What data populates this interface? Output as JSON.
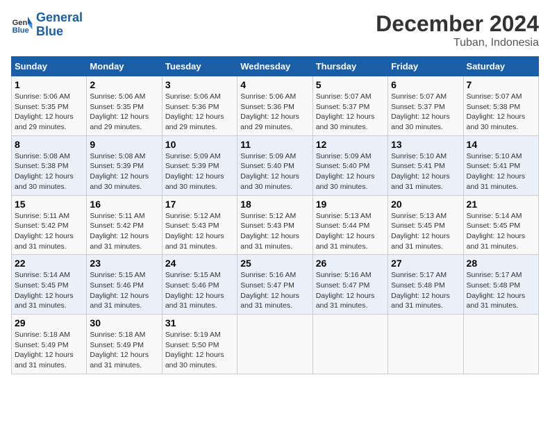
{
  "header": {
    "logo_text_general": "General",
    "logo_text_blue": "Blue",
    "title": "December 2024",
    "subtitle": "Tuban, Indonesia"
  },
  "calendar": {
    "days_of_week": [
      "Sunday",
      "Monday",
      "Tuesday",
      "Wednesday",
      "Thursday",
      "Friday",
      "Saturday"
    ],
    "weeks": [
      [
        null,
        null,
        null,
        null,
        null,
        null,
        null
      ]
    ],
    "rows": [
      {
        "cells": [
          {
            "day": "1",
            "sunrise": "5:06 AM",
            "sunset": "5:35 PM",
            "daylight": "12 hours and 29 minutes."
          },
          {
            "day": "2",
            "sunrise": "5:06 AM",
            "sunset": "5:35 PM",
            "daylight": "12 hours and 29 minutes."
          },
          {
            "day": "3",
            "sunrise": "5:06 AM",
            "sunset": "5:36 PM",
            "daylight": "12 hours and 29 minutes."
          },
          {
            "day": "4",
            "sunrise": "5:06 AM",
            "sunset": "5:36 PM",
            "daylight": "12 hours and 29 minutes."
          },
          {
            "day": "5",
            "sunrise": "5:07 AM",
            "sunset": "5:37 PM",
            "daylight": "12 hours and 30 minutes."
          },
          {
            "day": "6",
            "sunrise": "5:07 AM",
            "sunset": "5:37 PM",
            "daylight": "12 hours and 30 minutes."
          },
          {
            "day": "7",
            "sunrise": "5:07 AM",
            "sunset": "5:38 PM",
            "daylight": "12 hours and 30 minutes."
          }
        ]
      },
      {
        "cells": [
          {
            "day": "8",
            "sunrise": "5:08 AM",
            "sunset": "5:38 PM",
            "daylight": "12 hours and 30 minutes."
          },
          {
            "day": "9",
            "sunrise": "5:08 AM",
            "sunset": "5:39 PM",
            "daylight": "12 hours and 30 minutes."
          },
          {
            "day": "10",
            "sunrise": "5:09 AM",
            "sunset": "5:39 PM",
            "daylight": "12 hours and 30 minutes."
          },
          {
            "day": "11",
            "sunrise": "5:09 AM",
            "sunset": "5:40 PM",
            "daylight": "12 hours and 30 minutes."
          },
          {
            "day": "12",
            "sunrise": "5:09 AM",
            "sunset": "5:40 PM",
            "daylight": "12 hours and 30 minutes."
          },
          {
            "day": "13",
            "sunrise": "5:10 AM",
            "sunset": "5:41 PM",
            "daylight": "12 hours and 31 minutes."
          },
          {
            "day": "14",
            "sunrise": "5:10 AM",
            "sunset": "5:41 PM",
            "daylight": "12 hours and 31 minutes."
          }
        ]
      },
      {
        "cells": [
          {
            "day": "15",
            "sunrise": "5:11 AM",
            "sunset": "5:42 PM",
            "daylight": "12 hours and 31 minutes."
          },
          {
            "day": "16",
            "sunrise": "5:11 AM",
            "sunset": "5:42 PM",
            "daylight": "12 hours and 31 minutes."
          },
          {
            "day": "17",
            "sunrise": "5:12 AM",
            "sunset": "5:43 PM",
            "daylight": "12 hours and 31 minutes."
          },
          {
            "day": "18",
            "sunrise": "5:12 AM",
            "sunset": "5:43 PM",
            "daylight": "12 hours and 31 minutes."
          },
          {
            "day": "19",
            "sunrise": "5:13 AM",
            "sunset": "5:44 PM",
            "daylight": "12 hours and 31 minutes."
          },
          {
            "day": "20",
            "sunrise": "5:13 AM",
            "sunset": "5:45 PM",
            "daylight": "12 hours and 31 minutes."
          },
          {
            "day": "21",
            "sunrise": "5:14 AM",
            "sunset": "5:45 PM",
            "daylight": "12 hours and 31 minutes."
          }
        ]
      },
      {
        "cells": [
          {
            "day": "22",
            "sunrise": "5:14 AM",
            "sunset": "5:45 PM",
            "daylight": "12 hours and 31 minutes."
          },
          {
            "day": "23",
            "sunrise": "5:15 AM",
            "sunset": "5:46 PM",
            "daylight": "12 hours and 31 minutes."
          },
          {
            "day": "24",
            "sunrise": "5:15 AM",
            "sunset": "5:46 PM",
            "daylight": "12 hours and 31 minutes."
          },
          {
            "day": "25",
            "sunrise": "5:16 AM",
            "sunset": "5:47 PM",
            "daylight": "12 hours and 31 minutes."
          },
          {
            "day": "26",
            "sunrise": "5:16 AM",
            "sunset": "5:47 PM",
            "daylight": "12 hours and 31 minutes."
          },
          {
            "day": "27",
            "sunrise": "5:17 AM",
            "sunset": "5:48 PM",
            "daylight": "12 hours and 31 minutes."
          },
          {
            "day": "28",
            "sunrise": "5:17 AM",
            "sunset": "5:48 PM",
            "daylight": "12 hours and 31 minutes."
          }
        ]
      },
      {
        "cells": [
          {
            "day": "29",
            "sunrise": "5:18 AM",
            "sunset": "5:49 PM",
            "daylight": "12 hours and 31 minutes."
          },
          {
            "day": "30",
            "sunrise": "5:18 AM",
            "sunset": "5:49 PM",
            "daylight": "12 hours and 31 minutes."
          },
          {
            "day": "31",
            "sunrise": "5:19 AM",
            "sunset": "5:50 PM",
            "daylight": "12 hours and 30 minutes."
          },
          null,
          null,
          null,
          null
        ]
      }
    ]
  }
}
